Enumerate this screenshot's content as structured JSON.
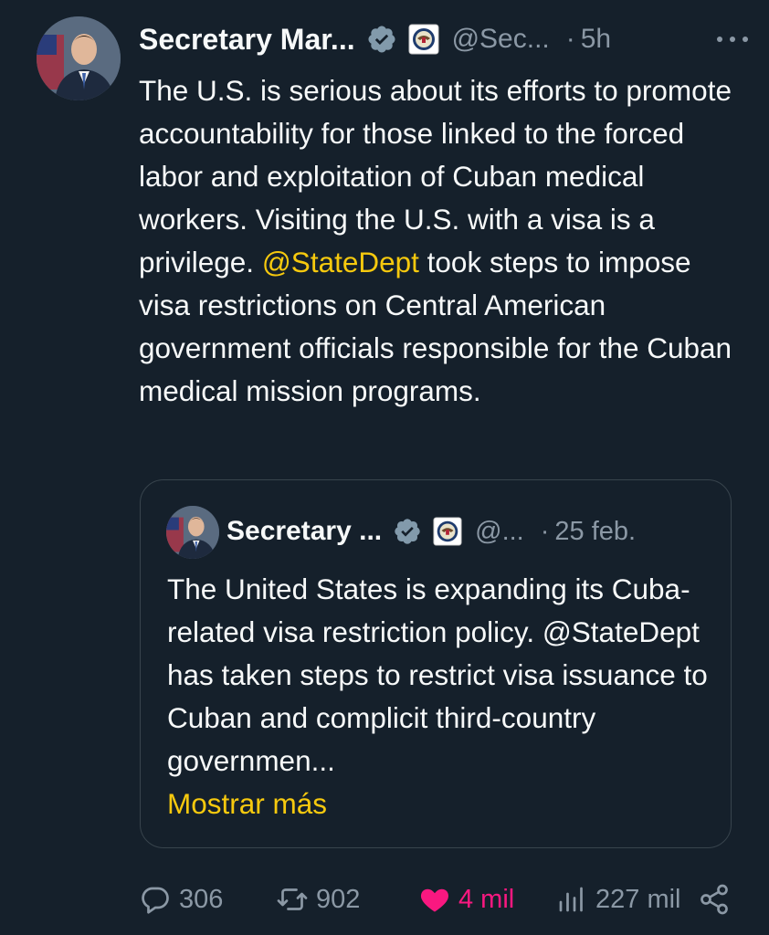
{
  "tweet": {
    "author_name": "Secretary Mar...",
    "handle": "@Sec...",
    "separator": "·",
    "time": "5h",
    "text_before_mention": "The U.S. is serious about its efforts to promote accountability for those linked to the forced labor and exploitation of Cuban medical workers. Visiting the U.S. with a visa is a privilege. ",
    "mention": "@StateDept",
    "text_after_mention": " took steps to impose visa restrictions on Central American government officials responsible for the Cuban medical mission programs."
  },
  "quoted_tweet": {
    "author_name": "Secretary ...",
    "handle": "@...",
    "separator": "·",
    "date": "25 feb.",
    "text": "The United States is expanding its Cuba-related visa restriction policy. @StateDept has taken steps to restrict visa issuance to Cuban and complicit third-country governmen...",
    "show_more": "Mostrar más"
  },
  "actions": {
    "replies": "306",
    "reposts": "902",
    "likes": "4 mil",
    "views": "227 mil"
  },
  "colors": {
    "background": "#15202b",
    "accent_link": "#f6c90e",
    "like": "#f91880",
    "muted": "#8b98a5",
    "verified_badge": "#829aab"
  }
}
